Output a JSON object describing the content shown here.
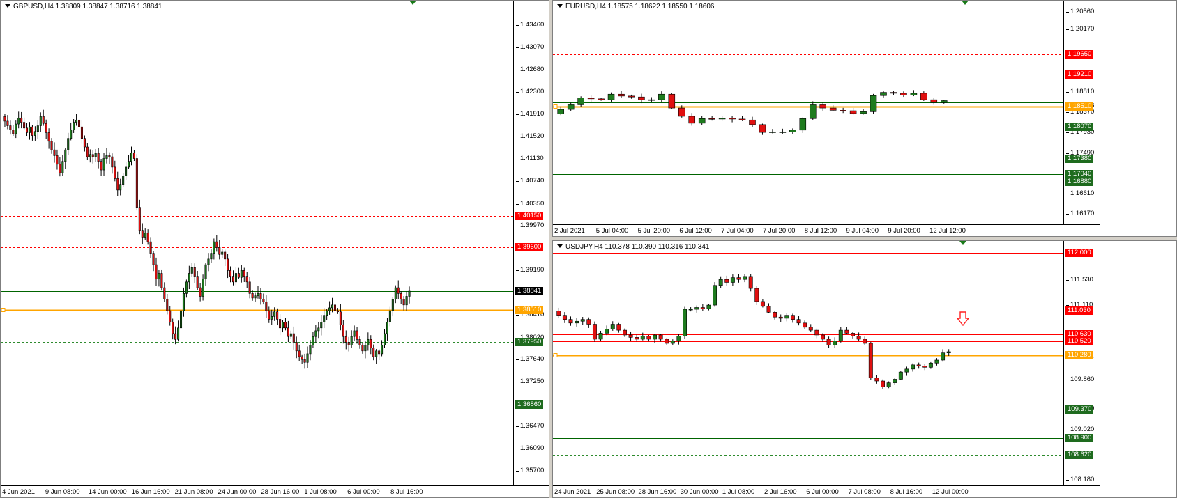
{
  "colors": {
    "up": "#1e7b1e",
    "down": "#e01010",
    "orange": "#ffa500",
    "red_level": "#ff0000",
    "green_level": "#006400",
    "green_dash": "#2e8b2e",
    "red_tag": "#ff0000",
    "green_tag": "#1e6b1e",
    "orange_tag": "#ffa500",
    "black_tag": "#000000"
  },
  "charts": [
    {
      "id": "gbpusd",
      "title": "GBPUSD,H4  1.38809 1.38847 1.38716 1.38841",
      "ymin": 1.3553,
      "ymax": 1.438,
      "yticks": [
        "1.43460",
        "1.43070",
        "1.42680",
        "1.42300",
        "1.41910",
        "1.41520",
        "1.41130",
        "1.40740",
        "1.40350",
        "1.39970",
        "1.39190",
        "1.38410",
        "1.38020",
        "1.37640",
        "1.37250",
        "1.36470",
        "1.36090",
        "1.35700"
      ],
      "xticks": [
        "4 Jun 2021",
        "9 Jun 08:00",
        "14 Jun 00:00",
        "16 Jun 16:00",
        "21 Jun 08:00",
        "24 Jun 00:00",
        "28 Jun 16:00",
        "1 Jul 08:00",
        "6 Jul 00:00",
        "8 Jul 16:00"
      ],
      "levels": [
        {
          "price": 1.4015,
          "label": "1.40150",
          "style": "red-dash",
          "tag": "red"
        },
        {
          "price": 1.396,
          "label": "1.39600",
          "style": "red-dash",
          "tag": "red"
        },
        {
          "price": 1.38841,
          "label": "1.38841",
          "style": "green-solid",
          "tag": "black"
        },
        {
          "price": 1.3851,
          "label": "1.38510",
          "style": "orange-solid",
          "tag": "orange"
        },
        {
          "price": 1.3795,
          "label": "1.37950",
          "style": "green-dash",
          "tag": "green"
        },
        {
          "price": 1.3686,
          "label": "1.36860",
          "style": "green-dash",
          "tag": "green"
        }
      ],
      "closes": [
        1.418,
        1.4172,
        1.4165,
        1.4158,
        1.4175,
        1.4185,
        1.4178,
        1.4168,
        1.416,
        1.417,
        1.4155,
        1.4162,
        1.4172,
        1.4188,
        1.4176,
        1.416,
        1.4145,
        1.413,
        1.412,
        1.4105,
        1.409,
        1.411,
        1.413,
        1.415,
        1.4165,
        1.4178,
        1.4182,
        1.417,
        1.415,
        1.4135,
        1.4118,
        1.4122,
        1.4118,
        1.4124,
        1.411,
        1.4095,
        1.4115,
        1.412,
        1.4118,
        1.41,
        1.408,
        1.406,
        1.407,
        1.4085,
        1.41,
        1.411,
        1.4125,
        1.4115,
        1.403,
        1.399,
        1.3978,
        1.3985,
        1.397,
        1.395,
        1.393,
        1.3905,
        1.3915,
        1.389,
        1.387,
        1.385,
        1.383,
        1.381,
        1.38,
        1.382,
        1.385,
        1.388,
        1.39,
        1.3915,
        1.3925,
        1.391,
        1.389,
        1.3875,
        1.3905,
        1.393,
        1.394,
        1.395,
        1.397,
        1.396,
        1.3948,
        1.3952,
        1.394,
        1.392,
        1.391,
        1.39,
        1.3915,
        1.3908,
        1.392,
        1.391,
        1.39,
        1.388,
        1.3872,
        1.3876,
        1.388,
        1.387,
        1.3865,
        1.385,
        1.3835,
        1.384,
        1.3848,
        1.3835,
        1.382,
        1.383,
        1.382,
        1.3805,
        1.381,
        1.3795,
        1.378,
        1.377,
        1.3765,
        1.376,
        1.3775,
        1.379,
        1.3805,
        1.3815,
        1.382,
        1.383,
        1.3842,
        1.385,
        1.3855,
        1.386,
        1.385,
        1.3848,
        1.3825,
        1.3805,
        1.3795,
        1.379,
        1.3805,
        1.3815,
        1.38,
        1.379,
        1.378,
        1.379,
        1.38,
        1.3785,
        1.377,
        1.378,
        1.3775,
        1.379,
        1.381,
        1.383,
        1.385,
        1.387,
        1.389,
        1.388,
        1.387,
        1.386,
        1.3875,
        1.3884
      ]
    },
    {
      "id": "eurusd",
      "title": "EURUSD,H4  1.18575 1.18622 1.18550 1.18606",
      "ymin": 1.16,
      "ymax": 1.2072,
      "yticks": [
        "1.20560",
        "1.20170",
        "1.18810",
        "1.18506",
        "1.18370",
        "1.17930",
        "1.17490",
        "1.16610",
        "1.16170"
      ],
      "xticks": [
        "2 Jul 2021",
        "5 Jul 04:00",
        "5 Jul 20:00",
        "6 Jul 12:00",
        "7 Jul 04:00",
        "7 Jul 20:00",
        "8 Jul 12:00",
        "9 Jul 04:00",
        "9 Jul 20:00",
        "12 Jul 12:00"
      ],
      "levels": [
        {
          "price": 1.1965,
          "label": "1.19650",
          "style": "red-dash",
          "tag": "red"
        },
        {
          "price": 1.1921,
          "label": "1.19210",
          "style": "red-dash",
          "tag": "red"
        },
        {
          "price": 1.18606,
          "label": "1.18606",
          "style": "green-solid",
          "tag": "none"
        },
        {
          "price": 1.1851,
          "label": "1.18510",
          "style": "orange-solid",
          "tag": "orange"
        },
        {
          "price": 1.1807,
          "label": "1.18070",
          "style": "green-dash",
          "tag": "green"
        },
        {
          "price": 1.1738,
          "label": "1.17380",
          "style": "green-dash",
          "tag": "green"
        },
        {
          "price": 1.1704,
          "label": "1.17040",
          "style": "green-solid",
          "tag": "green"
        },
        {
          "price": 1.1688,
          "label": "1.16880",
          "style": "green-solid",
          "tag": "green"
        }
      ],
      "closes": [
        1.1845,
        1.1855,
        1.187,
        1.1868,
        1.1866,
        1.1878,
        1.1874,
        1.1872,
        1.1866,
        1.1866,
        1.1878,
        1.1848,
        1.183,
        1.1815,
        1.1825,
        1.1824,
        1.1826,
        1.1824,
        1.1822,
        1.1812,
        1.1795,
        1.1796,
        1.1796,
        1.18,
        1.1825,
        1.1855,
        1.1848,
        1.1843,
        1.1842,
        1.1836,
        1.184,
        1.1875,
        1.1882,
        1.188,
        1.1876,
        1.188,
        1.1866,
        1.186,
        1.1864
      ]
    },
    {
      "id": "usdjpy",
      "title": "USDJPY,H4  110.378 110.390 110.316 110.341",
      "ymin": 108.16,
      "ymax": 112.1,
      "yticks": [
        "111.530",
        "111.110",
        "110.241",
        "109.860",
        "109.370",
        "109.020",
        "108.180"
      ],
      "xticks": [
        "24 Jun 2021",
        "25 Jun 08:00",
        "28 Jun 16:00",
        "30 Jun 00:00",
        "1 Jul 08:00",
        "2 Jul 16:00",
        "6 Jul 00:00",
        "7 Jul 08:00",
        "8 Jul 16:00",
        "12 Jul 00:00"
      ],
      "levels": [
        {
          "price": 112.0,
          "label": "112.000",
          "style": "red-solid",
          "tag": "red"
        },
        {
          "price": 111.95,
          "label": "",
          "style": "red-dash",
          "tag": "none"
        },
        {
          "price": 111.03,
          "label": "111.030",
          "style": "red-dash",
          "tag": "red"
        },
        {
          "price": 110.63,
          "label": "110.630",
          "style": "red-solid",
          "tag": "red"
        },
        {
          "price": 110.52,
          "label": "110.520",
          "style": "red-solid",
          "tag": "red"
        },
        {
          "price": 110.341,
          "label": "110.341",
          "style": "green-solid",
          "tag": "none"
        },
        {
          "price": 110.28,
          "label": "110.280",
          "style": "orange-solid",
          "tag": "orange"
        },
        {
          "price": 109.37,
          "label": "109.370",
          "style": "green-dash",
          "tag": "green"
        },
        {
          "price": 108.9,
          "label": "108.900",
          "style": "green-solid",
          "tag": "green"
        },
        {
          "price": 108.62,
          "label": "108.620",
          "style": "green-dash",
          "tag": "green"
        }
      ],
      "closes": [
        110.95,
        110.88,
        110.82,
        110.85,
        110.88,
        110.8,
        110.55,
        110.65,
        110.72,
        110.8,
        110.7,
        110.62,
        110.58,
        110.55,
        110.6,
        110.55,
        110.62,
        110.55,
        110.48,
        110.52,
        110.6,
        111.05,
        111.05,
        111.08,
        111.06,
        111.12,
        111.45,
        111.55,
        111.5,
        111.58,
        111.55,
        111.6,
        111.4,
        111.18,
        111.1,
        111.0,
        110.92,
        110.9,
        110.95,
        110.88,
        110.82,
        110.75,
        110.7,
        110.62,
        110.55,
        110.45,
        110.52,
        110.7,
        110.65,
        110.6,
        110.55,
        110.48,
        109.9,
        109.85,
        109.75,
        109.82,
        109.88,
        110.0,
        110.05,
        110.12,
        110.1,
        110.08,
        110.15,
        110.2,
        110.32,
        110.34
      ]
    }
  ]
}
